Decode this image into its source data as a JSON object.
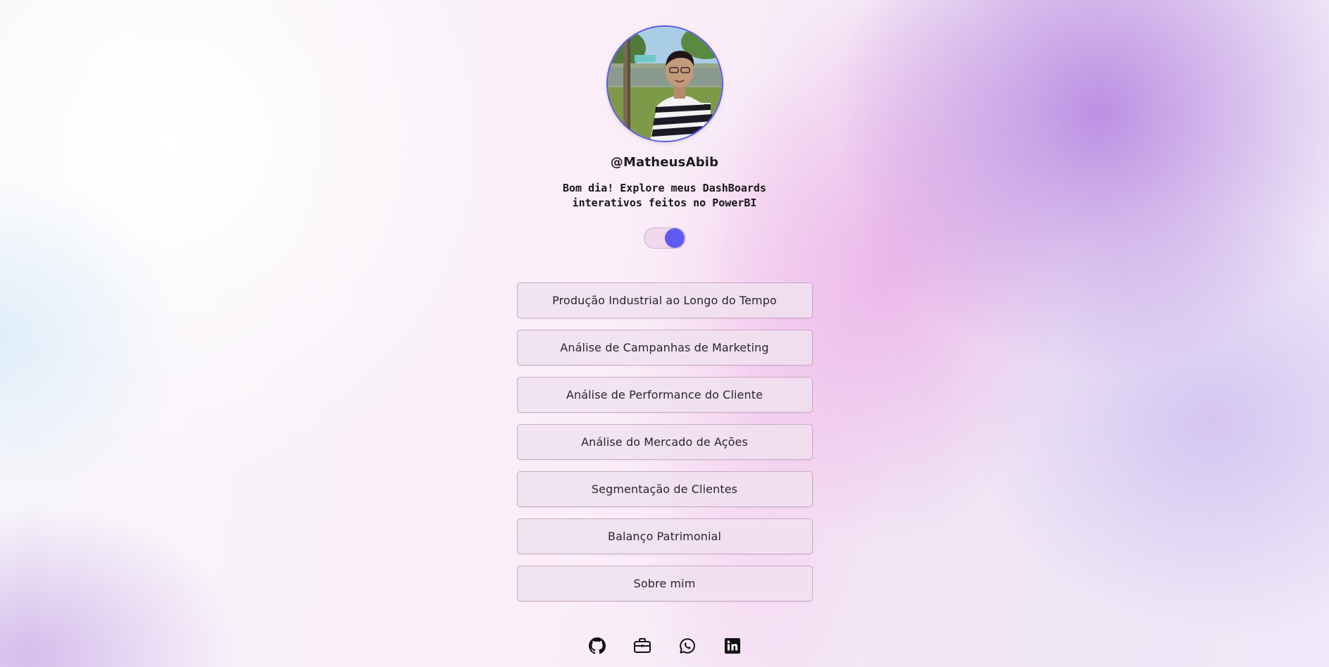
{
  "profile": {
    "handle": "@MatheusAbib",
    "tagline": "Bom dia! Explore meus DashBoards interativos feitos no PowerBI",
    "avatar_alt": "profile photo"
  },
  "theme_toggle": {
    "state": "on",
    "knob_color": "#5d5bf0"
  },
  "links": [
    {
      "label": "Produção Industrial ao Longo do Tempo"
    },
    {
      "label": "Análise de Campanhas de Marketing"
    },
    {
      "label": "Análise de Performance do Cliente"
    },
    {
      "label": "Análise do Mercado de Ações"
    },
    {
      "label": "Segmentação de Clientes"
    },
    {
      "label": "Balanço Patrimonial"
    },
    {
      "label": "Sobre mim"
    }
  ],
  "socials": [
    {
      "icon": "github-icon"
    },
    {
      "icon": "briefcase-icon"
    },
    {
      "icon": "whatsapp-icon"
    },
    {
      "icon": "linkedin-icon"
    }
  ],
  "colors": {
    "accent": "#5a56ea",
    "button_bg": "#f0e0ee",
    "button_border": "#c9a8c8"
  }
}
